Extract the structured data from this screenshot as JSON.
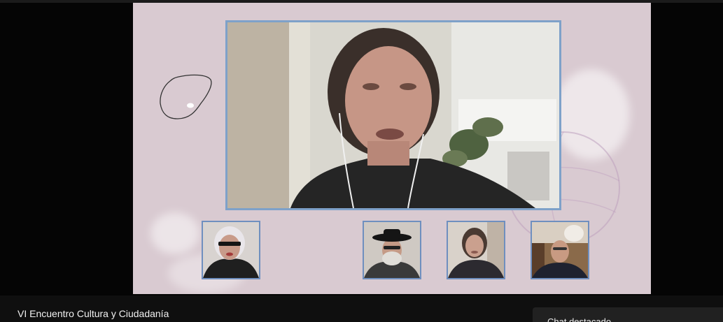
{
  "video": {
    "title": "VI Encuentro Cultura y Ciudadanía",
    "featured_chat_label": "Chat destacado"
  },
  "colors": {
    "stage_background": "#d9cad1",
    "main_border": "#7ea1c9",
    "tile_border": "#6f8fbf",
    "bottom_bar": "#0f0f0f"
  }
}
